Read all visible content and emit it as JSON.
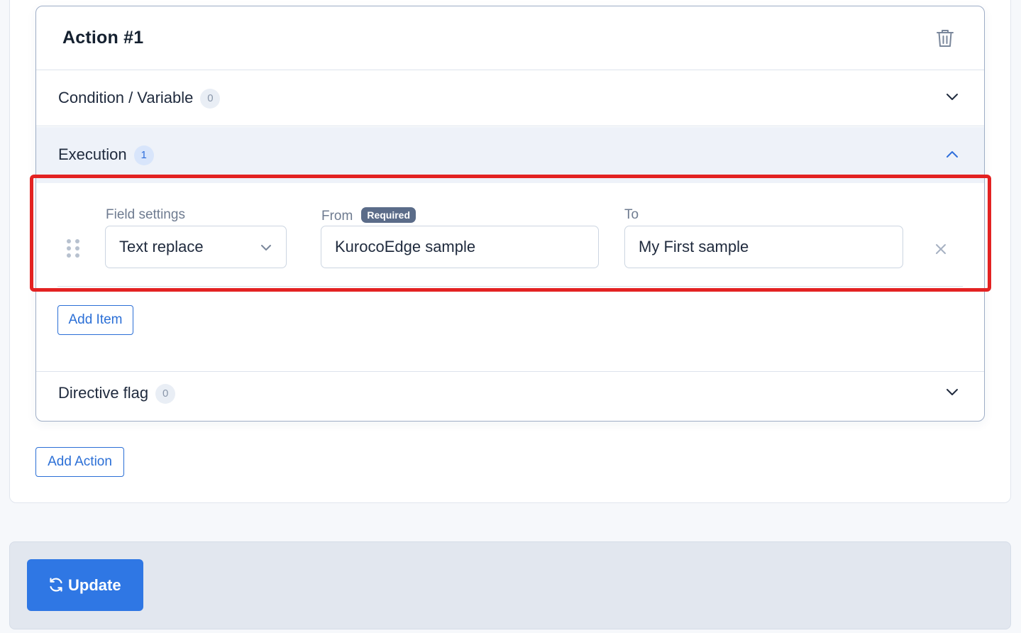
{
  "action": {
    "title": "Action #1",
    "delete_icon": "trash-icon"
  },
  "sections": {
    "condition": {
      "label": "Condition / Variable",
      "count": "0",
      "icon": "chevron-down-icon"
    },
    "execution": {
      "label": "Execution",
      "count": "1",
      "icon": "chevron-up-icon"
    },
    "directive": {
      "label": "Directive flag",
      "count": "0",
      "icon": "chevron-down-icon"
    }
  },
  "execution_item": {
    "field_settings": {
      "label": "Field settings",
      "value": "Text replace"
    },
    "from": {
      "label": "From",
      "required_badge": "Required",
      "value": "KurocoEdge sample"
    },
    "to": {
      "label": "To",
      "value": "My First sample"
    },
    "remove_icon": "close-icon",
    "drag_icon": "drag-handle-icon"
  },
  "buttons": {
    "add_item": "Add Item",
    "add_action": "Add Action",
    "update": "Update",
    "update_icon": "refresh-icon"
  },
  "colors": {
    "primary": "#2f77e4",
    "highlight": "#e32222",
    "required_badge": "#5b6c89"
  }
}
